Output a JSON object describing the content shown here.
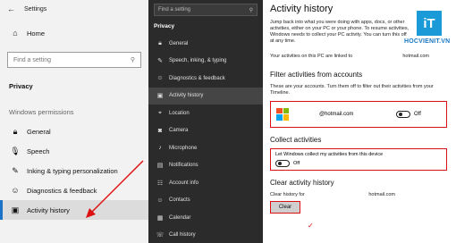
{
  "left": {
    "app_title": "Settings",
    "home": "Home",
    "search_placeholder": "Find a setting",
    "section": "Privacy",
    "group": "Windows permissions",
    "items": [
      {
        "label": "General",
        "icon": "lock-icon"
      },
      {
        "label": "Speech",
        "icon": "microphone-icon"
      },
      {
        "label": "Inking & typing personalization",
        "icon": "pen-icon"
      },
      {
        "label": "Diagnostics & feedback",
        "icon": "feedback-icon"
      },
      {
        "label": "Activity history",
        "icon": "timeline-icon"
      }
    ]
  },
  "mid": {
    "search_placeholder": "Find a setting",
    "header": "Privacy",
    "items": [
      {
        "label": "General",
        "icon": "lock-icon"
      },
      {
        "label": "Speech, inking, & typing",
        "icon": "pen-icon"
      },
      {
        "label": "Diagnostics & feedback",
        "icon": "feedback-icon"
      },
      {
        "label": "Activity history",
        "icon": "timeline-icon"
      },
      {
        "label": "Location",
        "icon": "location-icon"
      },
      {
        "label": "Camera",
        "icon": "camera-icon"
      },
      {
        "label": "Microphone",
        "icon": "microphone-icon"
      },
      {
        "label": "Notifications",
        "icon": "notifications-icon"
      },
      {
        "label": "Account info",
        "icon": "account-icon"
      },
      {
        "label": "Contacts",
        "icon": "contacts-icon"
      },
      {
        "label": "Calendar",
        "icon": "calendar-icon"
      },
      {
        "label": "Call history",
        "icon": "call-icon"
      }
    ]
  },
  "right": {
    "title": "Activity history",
    "intro": "Jump back into what you were doing with apps, docs, or other activities, either on your PC or your phone. To resume activities, Windows needs to collect your PC activity. You can turn this off at any time.",
    "linked_label": "Your activities on this PC are linked to",
    "linked_email": "hotmail.com",
    "filter_heading": "Filter activities from accounts",
    "filter_desc": "These are your accounts. Turn them off to filter out their activities from your Timeline.",
    "account_email": "@hotmail.com",
    "account_toggle": "Off",
    "collect_heading": "Collect activities",
    "collect_label": "Let Windows collect my activities from this device",
    "collect_toggle": "Off",
    "clear_heading": "Clear activity history",
    "clear_for": "Clear history for",
    "clear_email": "hotmail.com",
    "clear_button": "Clear"
  },
  "logo": {
    "text": "HOCVIENIT.VN",
    "mark": "iT"
  },
  "colors": {
    "accent": "#1a73c9",
    "highlight": "#dd1111"
  }
}
